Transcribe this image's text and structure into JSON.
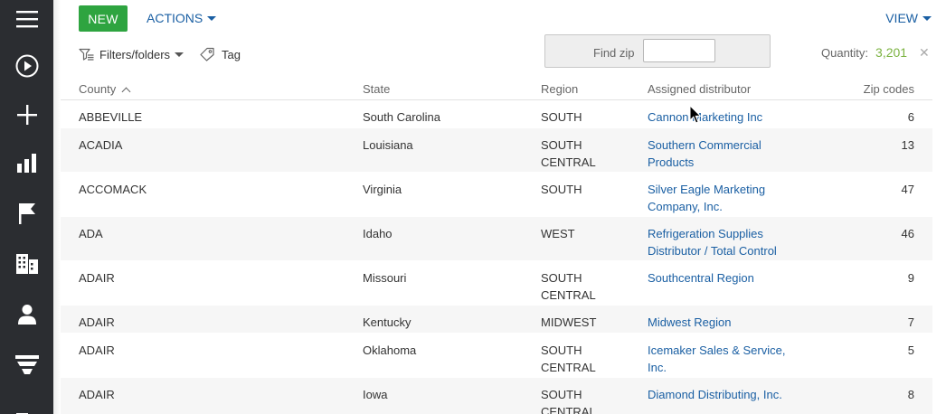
{
  "nav": {
    "items": [
      "menu-icon",
      "play-icon",
      "plus-icon",
      "bar-chart-icon",
      "flag-icon",
      "buildings-icon",
      "person-icon",
      "funnel-icon",
      "buildings-icon"
    ]
  },
  "toolbar": {
    "new_label": "NEW",
    "actions_label": "ACTIONS",
    "view_label": "VIEW",
    "filters_label": "Filters/folders",
    "tag_label": "Tag"
  },
  "findzip": {
    "label": "Find zip",
    "value": ""
  },
  "quantity": {
    "label": "Quantity:",
    "value": "3,201"
  },
  "table": {
    "headers": {
      "county": "County",
      "state": "State",
      "region": "Region",
      "distributor": "Assigned distributor",
      "zip": "Zip codes"
    },
    "rows": [
      {
        "county": "ABBEVILLE",
        "state": "South Carolina",
        "region1": "SOUTH",
        "region2": "",
        "dist1": "Cannon Marketing Inc",
        "dist2": "",
        "zip": "6"
      },
      {
        "county": "ACADIA",
        "state": "Louisiana",
        "region1": "SOUTH",
        "region2": "CENTRAL",
        "dist1": "Southern Commercial",
        "dist2": "Products",
        "zip": "13"
      },
      {
        "county": "ACCOMACK",
        "state": "Virginia",
        "region1": "SOUTH",
        "region2": "",
        "dist1": "Silver Eagle Marketing",
        "dist2": "Company, Inc.",
        "zip": "47"
      },
      {
        "county": "ADA",
        "state": "Idaho",
        "region1": "WEST",
        "region2": "",
        "dist1": "Refrigeration Supplies",
        "dist2": "Distributor / Total Control",
        "zip": "46"
      },
      {
        "county": "ADAIR",
        "state": "Missouri",
        "region1": "SOUTH",
        "region2": "CENTRAL",
        "dist1": "Southcentral Region",
        "dist2": "",
        "zip": "9"
      },
      {
        "county": "ADAIR",
        "state": "Kentucky",
        "region1": "MIDWEST",
        "region2": "",
        "dist1": "Midwest Region",
        "dist2": "",
        "zip": "7"
      },
      {
        "county": "ADAIR",
        "state": "Oklahoma",
        "region1": "SOUTH",
        "region2": "CENTRAL",
        "dist1": "Icemaker Sales & Service,",
        "dist2": "Inc.",
        "zip": "5"
      },
      {
        "county": "ADAIR",
        "state": "Iowa",
        "region1": "SOUTH",
        "region2": "CENTRAL",
        "dist1": "Diamond Distributing, Inc.",
        "dist2": "",
        "zip": "8"
      }
    ]
  },
  "colors": {
    "nav_bg": "#2b2d31",
    "new_button": "#2ea440",
    "link": "#1a5fa3",
    "quantity_value": "#7cb342"
  }
}
